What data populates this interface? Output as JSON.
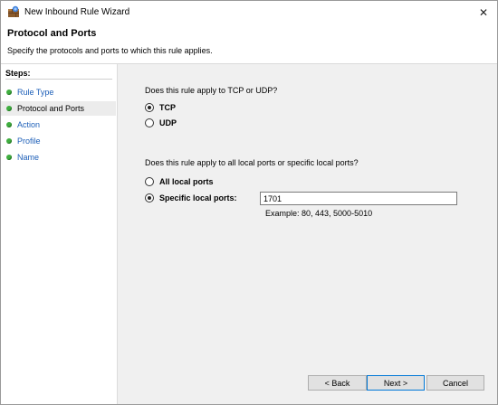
{
  "window": {
    "title": "New Inbound Rule Wizard",
    "close_glyph": "✕"
  },
  "header": {
    "title": "Protocol and Ports",
    "subtitle": "Specify the protocols and ports to which this rule applies."
  },
  "sidebar": {
    "steps_label": "Steps:",
    "items": [
      {
        "label": "Rule Type",
        "current": false
      },
      {
        "label": "Protocol and Ports",
        "current": true
      },
      {
        "label": "Action",
        "current": false
      },
      {
        "label": "Profile",
        "current": false
      },
      {
        "label": "Name",
        "current": false
      }
    ]
  },
  "protocol": {
    "question": "Does this rule apply to TCP or UDP?",
    "options": [
      {
        "label": "TCP",
        "checked": true
      },
      {
        "label": "UDP",
        "checked": false
      }
    ]
  },
  "ports": {
    "question": "Does this rule apply to all local ports or specific local ports?",
    "options": [
      {
        "label": "All local ports",
        "checked": false
      },
      {
        "label": "Specific local ports:",
        "checked": true
      }
    ],
    "value": "1701",
    "example": "Example: 80, 443, 5000-5010"
  },
  "buttons": {
    "back": "< Back",
    "next": "Next >",
    "cancel": "Cancel"
  },
  "colors": {
    "step_link": "#1d5fb8",
    "step_dot": "#3fae3f",
    "content_bg": "#f0f0f0"
  }
}
